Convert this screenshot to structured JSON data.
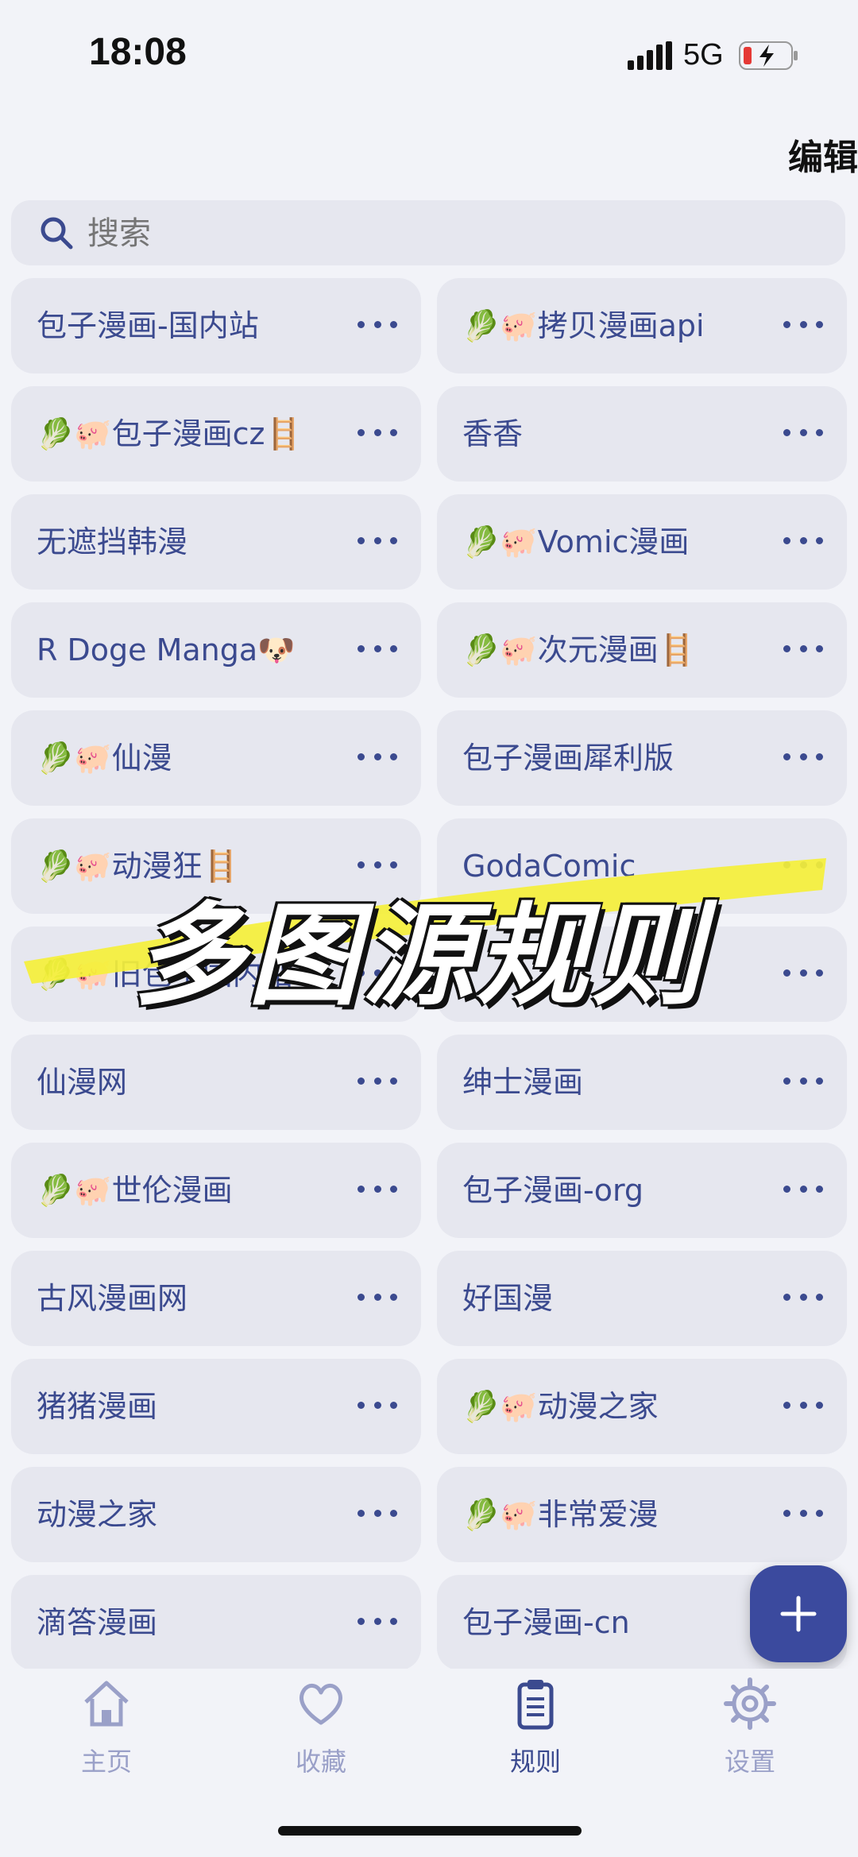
{
  "status": {
    "time": "18:08",
    "network": "5G"
  },
  "header": {
    "edit_label": "编辑"
  },
  "search": {
    "placeholder": "搜索"
  },
  "rules": [
    [
      "包子漫画-国内站",
      "🥬🐖拷贝漫画api"
    ],
    [
      "🥬🐖包子漫画cz🪜",
      "香香"
    ],
    [
      "无遮挡韩漫",
      "🥬🐖Vomic漫画"
    ],
    [
      "R Doge Manga🐶",
      "🥬🐖次元漫画🪜"
    ],
    [
      "🥬🐖仙漫",
      "包子漫画犀利版"
    ],
    [
      "🥬🐖动漫狂🪜",
      "GodaComic"
    ],
    [
      "🥬🐖旧包子国内站",
      ""
    ],
    [
      "仙漫网",
      "绅士漫画"
    ],
    [
      "🥬🐖世伦漫画",
      "包子漫画-org"
    ],
    [
      "古风漫画网",
      "好国漫"
    ],
    [
      "猪猪漫画",
      "🥬🐖动漫之家"
    ],
    [
      "动漫之家",
      "🥬🐖非常爱漫"
    ],
    [
      "滴答漫画",
      "包子漫画-cn"
    ]
  ],
  "overlay": {
    "title": "多图源规则"
  },
  "tabs": [
    {
      "label": "主页",
      "icon": "home-icon"
    },
    {
      "label": "收藏",
      "icon": "heart-icon"
    },
    {
      "label": "规则",
      "icon": "clipboard-icon",
      "active": true
    },
    {
      "label": "设置",
      "icon": "gear-icon"
    }
  ],
  "colors": {
    "accent": "#3b4a9e",
    "card": "#e6e7ef",
    "text": "#3b4a8f",
    "highlight": "#f5f03a"
  }
}
